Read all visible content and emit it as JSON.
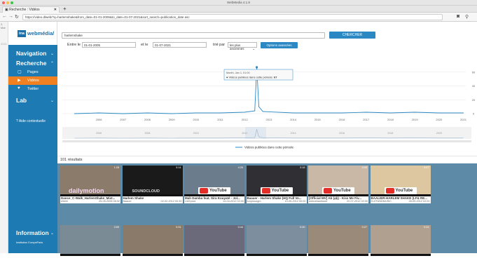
{
  "window": {
    "title": "WebMedia 4.1.8"
  },
  "tab": {
    "title": "Recherche : Vidéos",
    "close": "✕",
    "add": "+"
  },
  "address_bar": {
    "url": "https://video.dlweb/?q=harlemshake&from_date=01-01-2005&to_date=01-07-2021&sort_search=publication_date asc"
  },
  "left_pane": {
    "text": "2, Mar",
    "text2": "2021"
  },
  "sidebar": {
    "logo_box": "ina",
    "logo_text": "webmédia/",
    "navigation": "Navigation",
    "recherche": "Recherche",
    "items": [
      {
        "label": "Pages",
        "icon": "page-icon"
      },
      {
        "label": "Vidéos",
        "icon": "video-icon"
      },
      {
        "label": "Twitter",
        "icon": "twitter-icon"
      }
    ],
    "lab": "Lab",
    "help": "Aide contextuelle",
    "information": "Information",
    "institution": "Institution EuropeParis"
  },
  "search": {
    "query": "harlemshake",
    "button": "CHERCHER",
    "between_label": "Entre le",
    "from_date": "01-01-2005",
    "and_label": "et le",
    "to_date": "01-07-2021",
    "sort_label": "trié par",
    "sort_value": "les plus anciennes",
    "advanced": "Options avancées"
  },
  "chart_data": {
    "type": "line",
    "x_tick_labels": [
      "2006",
      "2007",
      "2008",
      "2009",
      "2010",
      "2011",
      "2012",
      "2013",
      "2014",
      "2015",
      "2016",
      "2017",
      "2018",
      "2019",
      "2020",
      "2021"
    ],
    "x": [
      "2005",
      "2006",
      "2007",
      "2008",
      "2009",
      "2010",
      "2011",
      "2012",
      "2012-12",
      "2013-01",
      "2013-02",
      "2013-04",
      "2014",
      "2015",
      "2016",
      "2017",
      "2018",
      "2019",
      "2020",
      "2021"
    ],
    "series": [
      {
        "name": "Vidéos publiées dans cette période",
        "values": [
          0,
          1,
          0,
          1,
          0,
          1,
          1,
          2,
          4,
          67,
          10,
          3,
          1,
          1,
          1,
          2,
          1,
          2,
          1,
          1
        ]
      }
    ],
    "ylim": [
      0,
      75
    ],
    "y_ticks": [
      0,
      20,
      40,
      60
    ],
    "tooltip": {
      "date": "Month, Jan 1, 01:00",
      "text": "Vidéos publiées dans cette période:",
      "value": "67"
    },
    "navigator_ticks": [
      "2006",
      "2008",
      "2010",
      "2012",
      "2014",
      "2016",
      "2018",
      "2020"
    ],
    "legend": "Vidéos publiées dans cette période"
  },
  "results": {
    "count": "101 résultats",
    "cards": [
      {
        "title": "Dance_C-Walk_HarlemShake_Mixt...",
        "author": "elibihi",
        "date": "25-05-2006 08:32",
        "duration": "1:28",
        "brand": "dailymotion"
      },
      {
        "title": "Harlem Shake",
        "author": "Baauer",
        "date": "02-02-2012 00:30",
        "duration": "3:14",
        "brand": "SOUNDCLOUD"
      },
      {
        "title": "Mah Damba feat. Sira Kouyaté - Jol...",
        "author": "LMZprod",
        "date": "14-04-2012 02:00",
        "duration": "4:26",
        "brand": "YouTube"
      },
      {
        "title": "Baauer - Harlem Shake (HQ Full Ve...",
        "author": "funpmuogm",
        "date": "10-05-2012 00:00",
        "duration": "3:18",
        "brand": "YouTube"
      },
      {
        "title": "[Official MV] Ab (a̲b̲) - Kiss Me Fiv...",
        "author": "webvekamfazer",
        "date": "22-07-2012 02:00",
        "duration": "4:49",
        "brand": "YouTube"
      },
      {
        "title": "BAALIER-HARLEM SHAKE (LF& RE...",
        "author": "ELEFANDMUSIC",
        "date": "28-09-2012 02:00",
        "duration": "4:47",
        "brand": "YouTube"
      },
      {
        "duration": "3:59"
      },
      {
        "duration": "0:31"
      },
      {
        "duration": "0:44"
      },
      {
        "duration": "0:30"
      },
      {
        "duration": "0:27"
      },
      {
        "duration": "0:31"
      }
    ]
  },
  "colors": {
    "accent": "#1d7ab2",
    "active": "#f08020",
    "chart_line": "#2b88c3"
  }
}
